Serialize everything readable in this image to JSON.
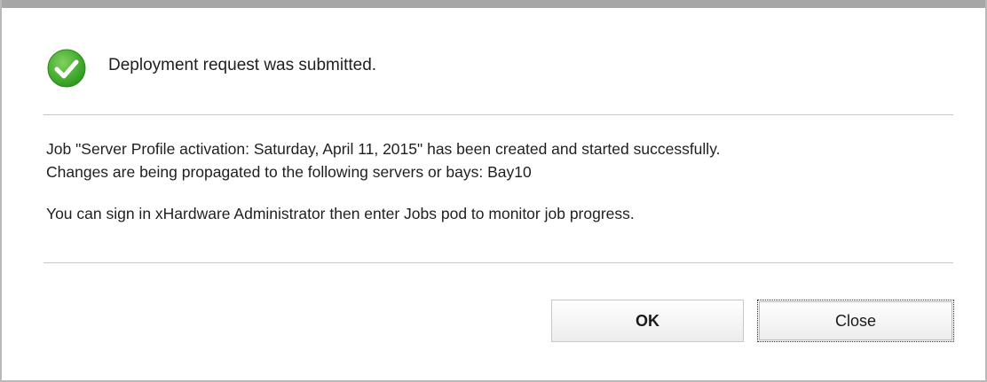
{
  "dialog": {
    "status_icon": "check-circle-icon",
    "headline": "Deployment request was submitted.",
    "message_line1": "Job \"Server Profile activation: Saturday, April 11, 2015\" has been created and started successfully.",
    "message_line2": "Changes are being propagated to the following servers or bays: Bay10",
    "message_line3": "You can sign in xHardware Administrator then enter Jobs pod to monitor job progress.",
    "ok_label": "OK",
    "close_label": "Close"
  },
  "colors": {
    "success_green": "#3fae2a",
    "top_bar": "#a6a6a6",
    "divider": "#c7c7c7"
  }
}
